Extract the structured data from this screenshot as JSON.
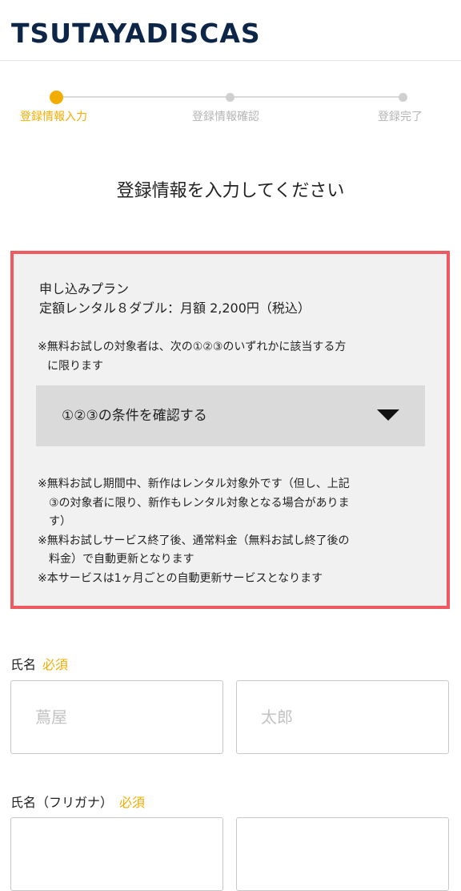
{
  "header": {
    "logo_text": "TSUTAYADISCAS"
  },
  "steps": [
    {
      "label": "登録情報入力",
      "state": "active"
    },
    {
      "label": "登録情報確認",
      "state": "inactive"
    },
    {
      "label": "登録完了",
      "state": "inactive"
    }
  ],
  "page_title": "登録情報を入力してください",
  "plan": {
    "label": "申し込みプラン",
    "name": "定額レンタル８ダブル：月額 2,200円（税込）",
    "trial_note_line1": "※無料お試しの対象者は、次の①②③のいずれかに該当する方",
    "trial_note_line2": "に限ります",
    "accordion_label": "①②③の条件を確認する",
    "notes": [
      {
        "line1": "※無料お試し期間中、新作はレンタル対象外です（但し、上記",
        "line2": "③の対象者に限り、新作もレンタル対象となる場合がありま",
        "line3": "す）"
      },
      {
        "line1": "※無料お試しサービス終了後、通常料金（無料お試し終了後の",
        "line2": "料金）で自動更新となります"
      },
      {
        "line1": "※本サービスは1ヶ月ごとの自動更新サービスとなります"
      }
    ]
  },
  "form": {
    "name_label": "氏名",
    "name_required": "必須",
    "last_name_placeholder": "蔦屋",
    "first_name_placeholder": "太郎",
    "kana_label": "氏名（フリガナ）",
    "kana_required": "必須"
  },
  "colors": {
    "accent": "#f2ad00",
    "highlight_border": "#ee5a5f",
    "logo": "#0d2547"
  },
  "icons": {
    "accordion": "caret-down-icon"
  }
}
